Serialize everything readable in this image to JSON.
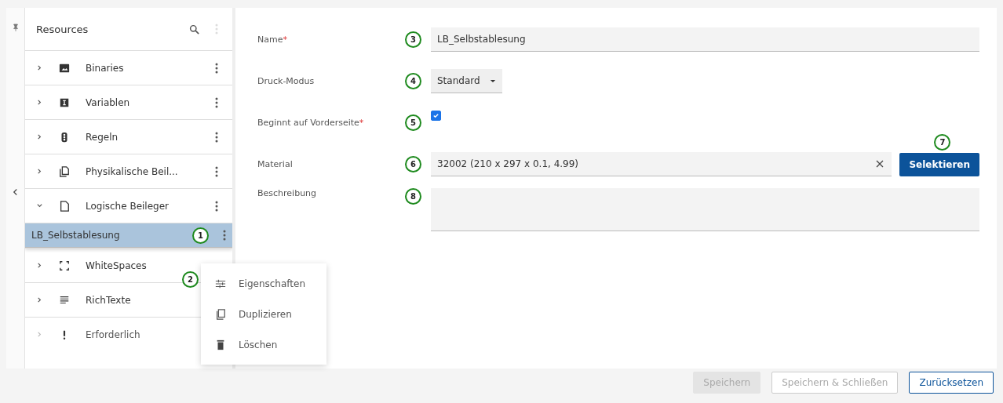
{
  "sidebar": {
    "title": "Resources",
    "items": [
      {
        "label": "Binaries",
        "expanded": false,
        "disabled": false
      },
      {
        "label": "Variablen",
        "expanded": false,
        "disabled": false
      },
      {
        "label": "Regeln",
        "expanded": false,
        "disabled": false
      },
      {
        "label": "Physikalische Beil...",
        "expanded": false,
        "disabled": false
      },
      {
        "label": "Logische Beileger",
        "expanded": true,
        "disabled": false,
        "children": [
          {
            "label": "LB_Selbstablesung",
            "selected": true,
            "marker": "1"
          }
        ]
      },
      {
        "label": "WhiteSpaces",
        "expanded": false,
        "disabled": false
      },
      {
        "label": "RichTexte",
        "expanded": false,
        "disabled": false
      },
      {
        "label": "Erforderlich",
        "expanded": false,
        "disabled": true
      }
    ]
  },
  "context_menu": {
    "marker": "2",
    "items": [
      {
        "label": "Eigenschaften"
      },
      {
        "label": "Duplizieren"
      },
      {
        "label": "Löschen"
      }
    ]
  },
  "form": [
    {
      "kind": "text",
      "label": "Name",
      "required_mark": "*",
      "marker": "3",
      "value": "LB_Selbstablesung"
    },
    {
      "kind": "select",
      "label": "Druck-Modus",
      "marker": "4",
      "value": "Standard"
    },
    {
      "kind": "checkbox",
      "label": "Beginnt auf Vorderseite",
      "required_mark": "*",
      "marker": "5",
      "checked": true
    },
    {
      "kind": "picker",
      "label": "Material",
      "marker": "6",
      "value": "32002 (210 x 297 x 0.1, 4.99)",
      "button": "Selektieren",
      "button_marker": "7"
    },
    {
      "kind": "textarea",
      "label": "Beschreibung",
      "marker": "8"
    }
  ],
  "footer": [
    {
      "label": "Speichern",
      "kind": "disabled"
    },
    {
      "label": "Speichern & Schließen",
      "kind": "outline-disabled"
    },
    {
      "label": "Zurücksetzen",
      "kind": "outline"
    }
  ]
}
